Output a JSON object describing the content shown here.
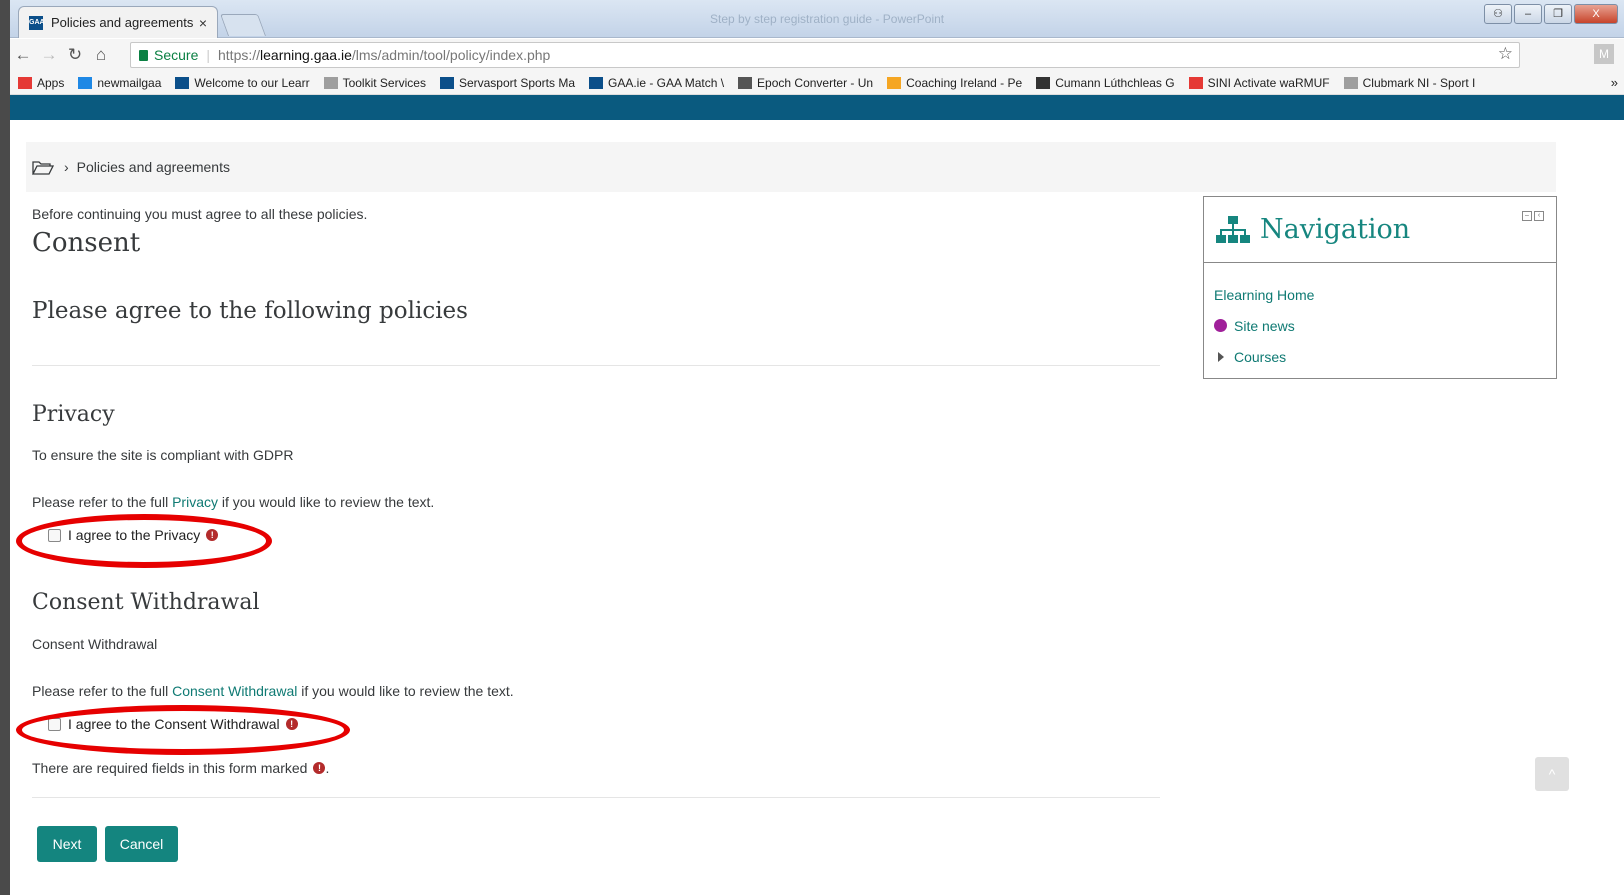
{
  "browser": {
    "tab_title": "Policies and agreements",
    "tab_close": "×",
    "favicon_text": "GAA",
    "window_title": "Step by step registration guide - PowerPoint",
    "window_buttons": {
      "account": "⚇",
      "minimize": "–",
      "maximize": "❐",
      "close": "X"
    },
    "secure_label": "Secure",
    "url_scheme": "https://",
    "url_host": "learning.gaa.ie",
    "url_path": "/lms/admin/tool/policy/index.php",
    "profile_initial": "M",
    "bookmarks": [
      {
        "label": "Apps",
        "icon": "apps-grid-icon",
        "color": "#e53935"
      },
      {
        "label": "newmailgaa",
        "icon": "calendar-icon",
        "color": "#1e88e5"
      },
      {
        "label": "Welcome to our Learr",
        "icon": "gaa-icon",
        "color": "#0b4f8a"
      },
      {
        "label": "Toolkit Services",
        "icon": "page-icon",
        "color": "#9e9e9e"
      },
      {
        "label": "Servasport Sports Ma",
        "icon": "gaa-icon",
        "color": "#0b4f8a"
      },
      {
        "label": "GAA.ie - GAA Match \\",
        "icon": "gaa-icon",
        "color": "#0b4f8a"
      },
      {
        "label": "Epoch Converter - Un",
        "icon": "clock-icon",
        "color": "#555555"
      },
      {
        "label": "Coaching Ireland - Pe",
        "icon": "coaching-icon",
        "color": "#f5a623"
      },
      {
        "label": "Cumann Lúthchleas G",
        "icon": "crest-icon",
        "color": "#333333"
      },
      {
        "label": "SINI Activate waRMUF",
        "icon": "sini-icon",
        "color": "#e53935"
      },
      {
        "label": "Clubmark NI - Sport I",
        "icon": "page-icon",
        "color": "#9e9e9e"
      }
    ],
    "bookmarks_overflow": "»"
  },
  "breadcrumb": {
    "separator": "›",
    "current": "Policies and agreements"
  },
  "page": {
    "intro": "Before continuing you must agree to all these policies.",
    "title": "Consent",
    "subtitle": "Please agree to the following policies"
  },
  "policies": [
    {
      "heading": "Privacy",
      "summary": "To ensure the site is compliant with GDPR",
      "refer_prefix": "Please refer to the full ",
      "link_text": "Privacy",
      "refer_suffix": " if you would like to review the text.",
      "agree_label": "I agree to the Privacy",
      "checked": false
    },
    {
      "heading": "Consent Withdrawal",
      "summary": "Consent Withdrawal",
      "refer_prefix": "Please refer to the full ",
      "link_text": "Consent Withdrawal",
      "refer_suffix": " if you would like to review the text.",
      "agree_label": "I agree to the Consent Withdrawal",
      "checked": false
    }
  ],
  "required_note": "There are required fields in this form marked",
  "required_note_end": ".",
  "required_symbol": "!",
  "buttons": {
    "next": "Next",
    "cancel": "Cancel"
  },
  "navigation": {
    "title": "Navigation",
    "items": [
      {
        "label": "Elearning Home"
      },
      {
        "label": "Site news"
      },
      {
        "label": "Courses"
      }
    ]
  },
  "colors": {
    "accent": "#14857f",
    "link": "#0f7a73",
    "brand_bar": "#0a5a7f",
    "annotation": "#e60000",
    "required": "#b32b2b"
  }
}
